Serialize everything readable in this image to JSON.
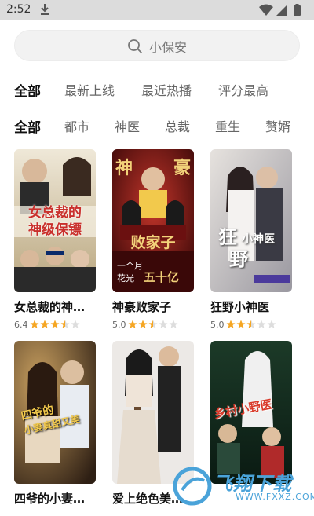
{
  "status": {
    "time": "2:52"
  },
  "search": {
    "text": "小保安"
  },
  "sort_tabs": [
    {
      "label": "全部",
      "active": true
    },
    {
      "label": "最新上线",
      "active": false
    },
    {
      "label": "最近热播",
      "active": false
    },
    {
      "label": "评分最高",
      "active": false
    }
  ],
  "genre_tabs": [
    {
      "label": "全部",
      "active": true
    },
    {
      "label": "都市",
      "active": false
    },
    {
      "label": "神医",
      "active": false
    },
    {
      "label": "总裁",
      "active": false
    },
    {
      "label": "重生",
      "active": false
    },
    {
      "label": "赘婿",
      "active": false
    }
  ],
  "cards": [
    {
      "title": "女总裁的神…",
      "score": "6.4",
      "stars": 3.5,
      "poster_text": [
        "女总裁的",
        "神级保镖"
      ],
      "poster_colors": [
        "#e9e1cf",
        "#8a7a5a",
        "#c9302c"
      ]
    },
    {
      "title": "神豪败家子",
      "score": "5.0",
      "stars": 2.5,
      "poster_text": [
        "神",
        "豪",
        "败家子",
        "一个月",
        "花光",
        "五十亿"
      ],
      "poster_colors": [
        "#5a0f0f",
        "#b3241c",
        "#f2c94c"
      ]
    },
    {
      "title": "狂野小神医",
      "score": "5.0",
      "stars": 2.5,
      "poster_text": [
        "狂",
        "野",
        "小神医"
      ],
      "poster_colors": [
        "#d9d4cf",
        "#8c8b90",
        "#5b4b6b"
      ]
    },
    {
      "title": "四爷的小妻…",
      "score": "",
      "stars": 0,
      "poster_text": [
        "四爷的",
        "小妻真甜又美"
      ],
      "poster_colors": [
        "#3a2a1e",
        "#8a6a3a",
        "#e0b060"
      ]
    },
    {
      "title": "爱上绝色美…",
      "score": "",
      "stars": 0,
      "poster_text": [],
      "poster_colors": [
        "#e8e6e4",
        "#2a2a2a",
        "#c9b8a8"
      ]
    },
    {
      "title": "",
      "score": "",
      "stars": 0,
      "poster_text": [
        "乡村小野医"
      ],
      "poster_colors": [
        "#0e2a1c",
        "#3c6b4a",
        "#c9302c"
      ]
    }
  ],
  "watermark": {
    "brand": "飞翔下载",
    "url": "WWW.FXXZ.COM"
  }
}
